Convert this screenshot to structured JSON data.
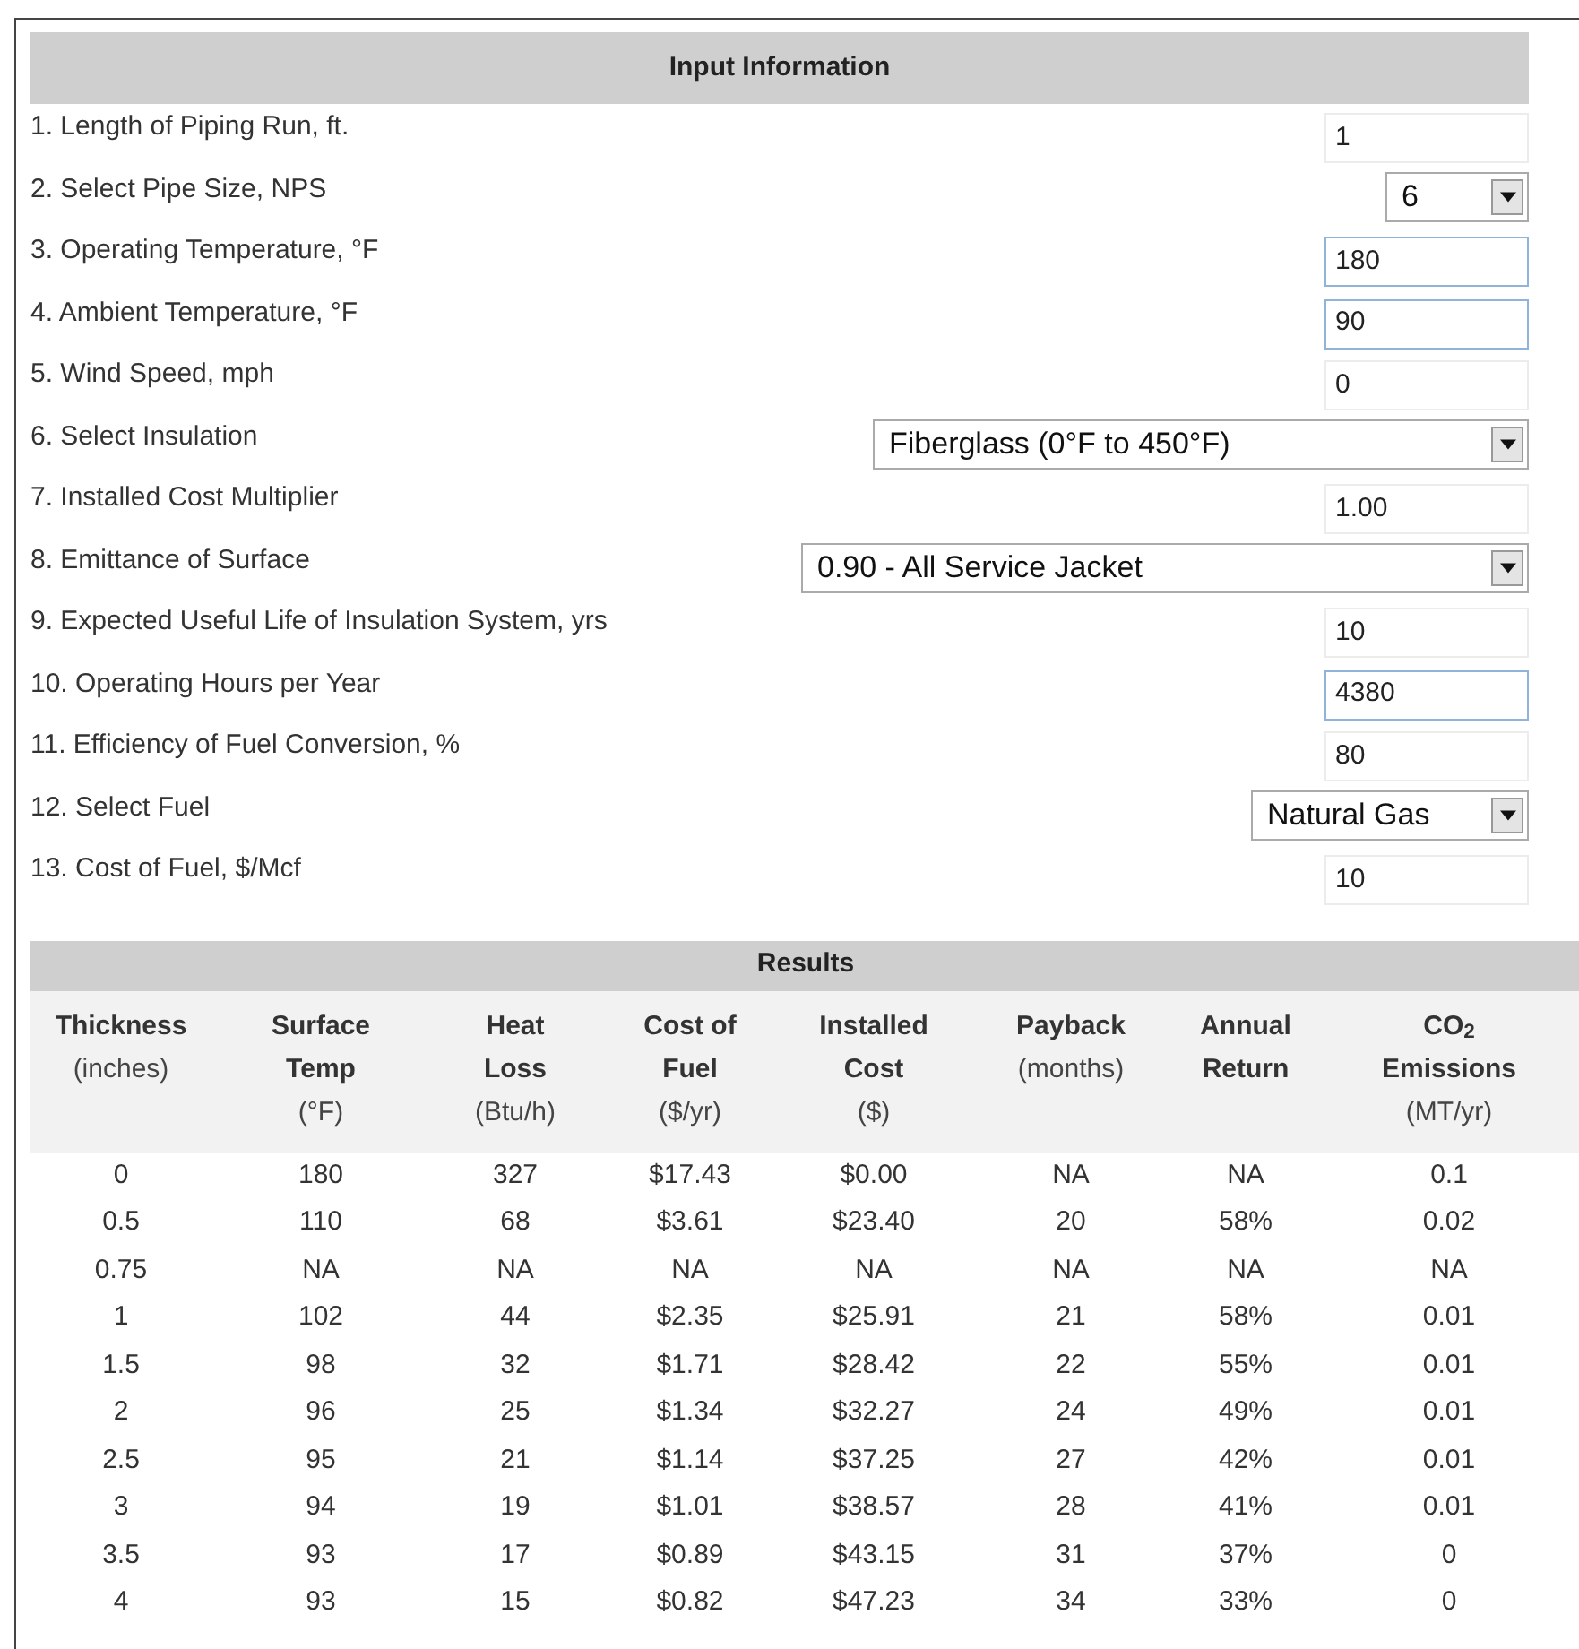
{
  "input_section": {
    "title": "Input Information",
    "rows": [
      {
        "label": "1. Length of Piping Run, ft.",
        "kind": "text",
        "value": "1",
        "highlighted": false
      },
      {
        "label": "2. Select Pipe Size, NPS",
        "kind": "select",
        "value": "6"
      },
      {
        "label": "3. Operating Temperature, °F",
        "kind": "text",
        "value": "180",
        "highlighted": true
      },
      {
        "label": "4. Ambient Temperature, °F",
        "kind": "text",
        "value": "90",
        "highlighted": true
      },
      {
        "label": "5. Wind Speed, mph",
        "kind": "text",
        "value": "0",
        "highlighted": false
      },
      {
        "label": "6. Select Insulation",
        "kind": "select",
        "value": "Fiberglass (0°F to 450°F)"
      },
      {
        "label": "7. Installed Cost Multiplier",
        "kind": "text",
        "value": "1.00",
        "highlighted": false
      },
      {
        "label": "8. Emittance of Surface",
        "kind": "select",
        "value": "0.90 - All Service Jacket"
      },
      {
        "label": "9. Expected Useful Life of Insulation System, yrs",
        "kind": "text",
        "value": "10",
        "highlighted": false
      },
      {
        "label": "10. Operating Hours per Year",
        "kind": "text",
        "value": "4380",
        "highlighted": true
      },
      {
        "label": "11. Efficiency of Fuel Conversion, %",
        "kind": "text",
        "value": "80",
        "highlighted": false
      },
      {
        "label": "12. Select Fuel",
        "kind": "select",
        "value": "Natural Gas"
      },
      {
        "label": "13. Cost of Fuel, $/Mcf",
        "kind": "text",
        "value": "10",
        "highlighted": false
      }
    ]
  },
  "results": {
    "title": "Results",
    "columns": [
      {
        "heading": "Thickness",
        "unit": "(inches)"
      },
      {
        "heading": "Surface\nTemp",
        "unit": "(°F)"
      },
      {
        "heading": "Heat\nLoss",
        "unit": "(Btu/h)"
      },
      {
        "heading": "Cost of\nFuel",
        "unit": "($/yr)"
      },
      {
        "heading": "Installed\nCost",
        "unit": "($)"
      },
      {
        "heading": "Payback",
        "unit": "(months)"
      },
      {
        "heading": "Annual\nReturn"
      },
      {
        "heading": "CO$_{2}$\nEmissions",
        "unit": "(MT/yr)"
      }
    ],
    "rows": [
      [
        "0",
        "180",
        "327",
        "$17.43",
        "$0.00",
        "NA",
        "NA",
        "0.1"
      ],
      [
        "0.5",
        "110",
        "68",
        "$3.61",
        "$23.40",
        "20",
        "58%",
        "0.02"
      ],
      [
        "0.75",
        "NA",
        "NA",
        "NA",
        "NA",
        "NA",
        "NA",
        "NA"
      ],
      [
        "1",
        "102",
        "44",
        "$2.35",
        "$25.91",
        "21",
        "58%",
        "0.01"
      ],
      [
        "1.5",
        "98",
        "32",
        "$1.71",
        "$28.42",
        "22",
        "55%",
        "0.01"
      ],
      [
        "2",
        "96",
        "25",
        "$1.34",
        "$32.27",
        "24",
        "49%",
        "0.01"
      ],
      [
        "2.5",
        "95",
        "21",
        "$1.14",
        "$37.25",
        "27",
        "42%",
        "0.01"
      ],
      [
        "3",
        "94",
        "19",
        "$1.01",
        "$38.57",
        "28",
        "41%",
        "0.01"
      ],
      [
        "3.5",
        "93",
        "17",
        "$0.89",
        "$43.15",
        "31",
        "37%",
        "0"
      ],
      [
        "4",
        "93",
        "15",
        "$0.82",
        "$47.23",
        "34",
        "33%",
        "0"
      ]
    ]
  }
}
